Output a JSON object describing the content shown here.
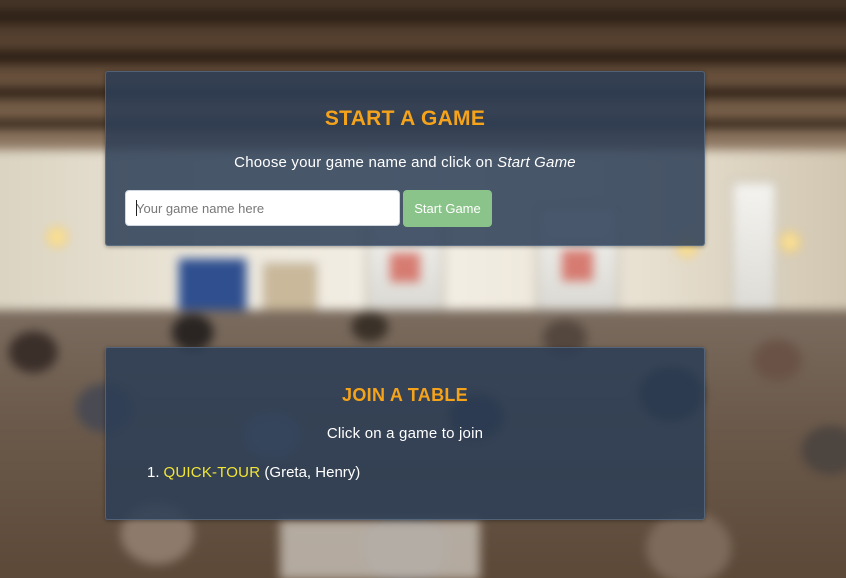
{
  "start_panel": {
    "title": "START A GAME",
    "subtitle_prefix": "Choose your game name and click on ",
    "subtitle_emphasis": "Start Game",
    "input_placeholder": "Your game name here",
    "input_value": "",
    "button_label": "Start Game"
  },
  "join_panel": {
    "title": "JOIN A TABLE",
    "subtitle": "Click on a game to join",
    "games": [
      {
        "number": "1.",
        "name": "QUICK-TOUR",
        "players": "(Greta, Henry)"
      }
    ]
  },
  "colors": {
    "title_accent": "#f5a31a",
    "link_color": "#f2e634",
    "button_green": "#8bc48a",
    "panel_bg": "#2c3e56"
  }
}
